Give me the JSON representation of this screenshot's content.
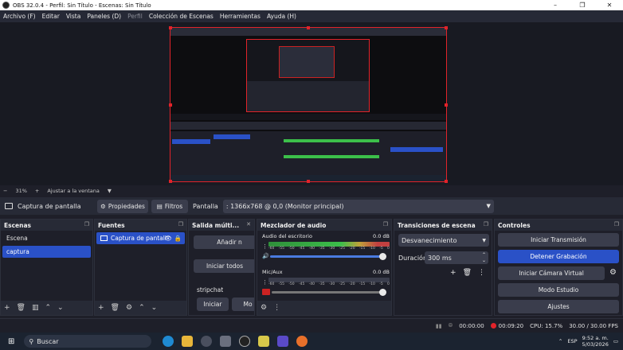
{
  "window": {
    "title": "OBS 32.0.4 - Perfil: Sin Título - Escenas: Sin Título",
    "min": "–",
    "max": "❐",
    "close": "✕"
  },
  "menu": [
    "Archivo (F)",
    "Editar",
    "Vista",
    "Paneles (D)",
    "Perfil",
    "Colección de Escenas",
    "Herramientas",
    "Ayuda (H)"
  ],
  "zoom": {
    "minus": "−",
    "value": "31%",
    "plus": "+",
    "fit": "Ajustar a la ventana",
    "caret": "▼"
  },
  "source_bar": {
    "source_name": "Captura de pantalla",
    "properties": "Propiedades",
    "filters": "Filtros",
    "display_label": "Pantalla",
    "display_value": ": 1366x768 @ 0,0 (Monitor principal)"
  },
  "scenes": {
    "title": "Escenas",
    "items": [
      "Escena",
      "captura"
    ],
    "selected": 1
  },
  "sources": {
    "title": "Fuentes",
    "items": [
      "Captura de pantall"
    ]
  },
  "multi": {
    "title": "Salida múlti...",
    "add": "Añadir n",
    "start_all": "Iniciar todos",
    "stream": "stripchat",
    "start": "Iniciar",
    "more": "Mo"
  },
  "mixer": {
    "title": "Mezclador de audio",
    "channels": [
      {
        "name": "Audio del escritorio",
        "db": "0.0 dB",
        "level": 0.98
      },
      {
        "name": "Mic/Aux",
        "db": "0.0 dB",
        "level": 0.98
      }
    ],
    "ticks": [
      "-60",
      "-55",
      "-50",
      "-45",
      "-40",
      "-35",
      "-30",
      "-25",
      "-20",
      "-15",
      "-10",
      "-5",
      "0"
    ]
  },
  "transitions": {
    "title": "Transiciones de escena",
    "type": "Desvanecimiento",
    "duration_label": "Duración",
    "duration_value": "300 ms"
  },
  "controls": {
    "title": "Controles",
    "start_stream": "Iniciar Transmisión",
    "stop_record": "Detener Grabación",
    "virtual_cam": "Iniciar Cámara Virtual",
    "studio": "Modo Estudio",
    "settings": "Ajustes"
  },
  "status": {
    "stream_time": "00:00:00",
    "rec_time": "00:09:20",
    "cpu": "CPU: 15.7%",
    "fps": "30.00 / 30.00 FPS"
  },
  "taskbar": {
    "search": "Buscar",
    "lang": "ESP",
    "time": "9:52 a. m.",
    "date": "5/03/2026"
  },
  "colors": {
    "accent": "#2a51c7",
    "canvas_border": "#e2232a",
    "bg": "#1e1f29"
  }
}
